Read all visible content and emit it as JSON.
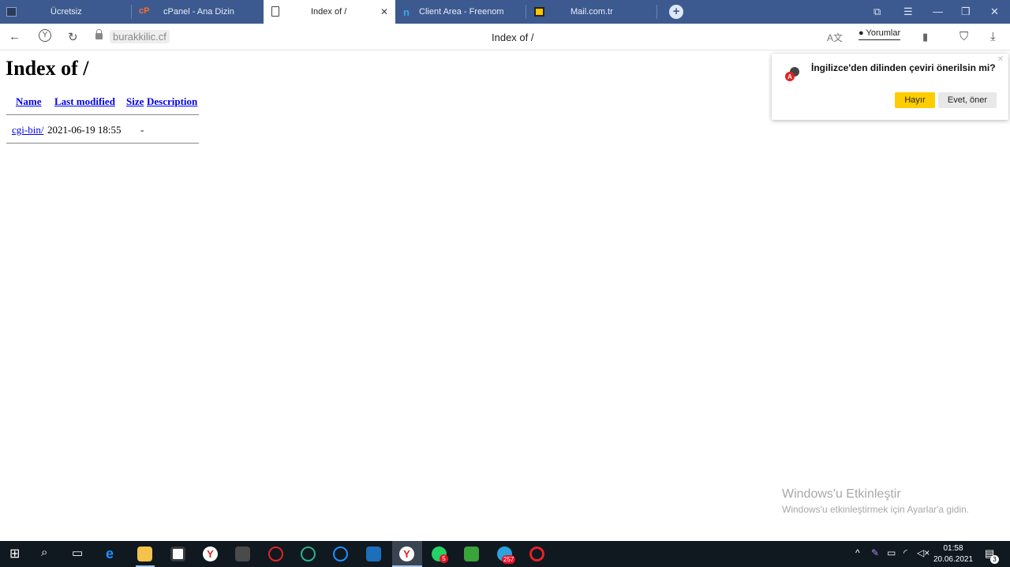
{
  "tabs": [
    {
      "label": "Ücretsiz",
      "icon": "site-icon"
    },
    {
      "label": "cPanel - Ana Dizin",
      "icon": "cpanel-icon"
    },
    {
      "label": "Index of /",
      "icon": "document-icon",
      "active": true
    },
    {
      "label": "Client Area - Freenom",
      "icon": "freenom-icon"
    },
    {
      "label": "Mail.com.tr",
      "icon": "mail-icon"
    }
  ],
  "address": {
    "url": "burakkilic.cf",
    "title": "Index of /",
    "comments_label": "Yorumlar"
  },
  "page": {
    "heading": "Index of /",
    "columns": [
      "Name",
      "Last modified",
      "Size",
      "Description"
    ],
    "rows": [
      {
        "name": "cgi-bin/",
        "modified": "2021-06-19 18:55",
        "size": "-",
        "description": ""
      }
    ]
  },
  "translate_popup": {
    "message": "İngilizce'den dilinden çeviri önerilsin mi?",
    "no_label": "Hayır",
    "yes_label": "Evet, öner"
  },
  "watermark": {
    "line1": "Windows'u Etkinleştir",
    "line2": "Windows'u etkinleştirmek için Ayarlar'a gidin."
  },
  "taskbar": {
    "time": "01:58",
    "date": "20.06.2021",
    "whatsapp_badge": "5",
    "telegram_badge": "257",
    "notification_badge": "3"
  },
  "colors": {
    "tabbar": "#3c5a8f",
    "accent_yellow": "#ffcc00",
    "link": "#0000ee"
  }
}
